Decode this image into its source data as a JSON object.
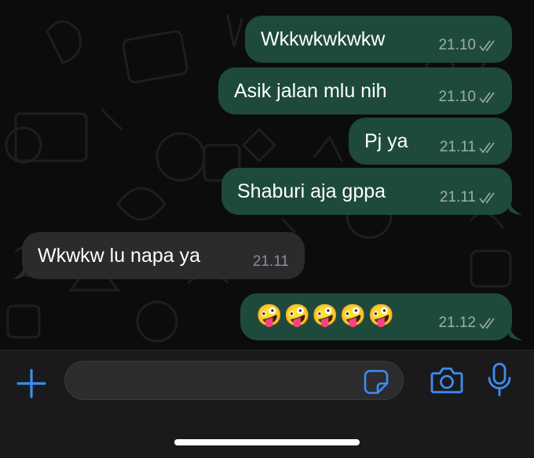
{
  "messages": [
    {
      "direction": "out",
      "text": "Wkkwkwkwkw",
      "time": "21.10",
      "status": "read"
    },
    {
      "direction": "out",
      "text": "Asik jalan mlu nih",
      "time": "21.10",
      "status": "read"
    },
    {
      "direction": "out",
      "text": "Pj ya",
      "time": "21.11",
      "status": "read"
    },
    {
      "direction": "out",
      "text": "Shaburi aja gppa",
      "time": "21.11",
      "status": "read"
    },
    {
      "direction": "in",
      "text": "Wkwkw lu napa ya",
      "time": "21.11"
    },
    {
      "direction": "out",
      "text": "🤪🤪🤪🤪🤪",
      "time": "21.12",
      "status": "read"
    }
  ],
  "composer": {
    "placeholder": "",
    "value": ""
  },
  "icons": {
    "attach": "plus-icon",
    "sticker": "sticker-icon",
    "camera": "camera-icon",
    "mic": "microphone-icon",
    "read_receipt": "double-check-icon"
  },
  "colors": {
    "outgoing_bubble": "#1e4a3b",
    "incoming_bubble": "#2b2b2d",
    "accent": "#3b8ef0",
    "background": "#0c0c0c"
  }
}
